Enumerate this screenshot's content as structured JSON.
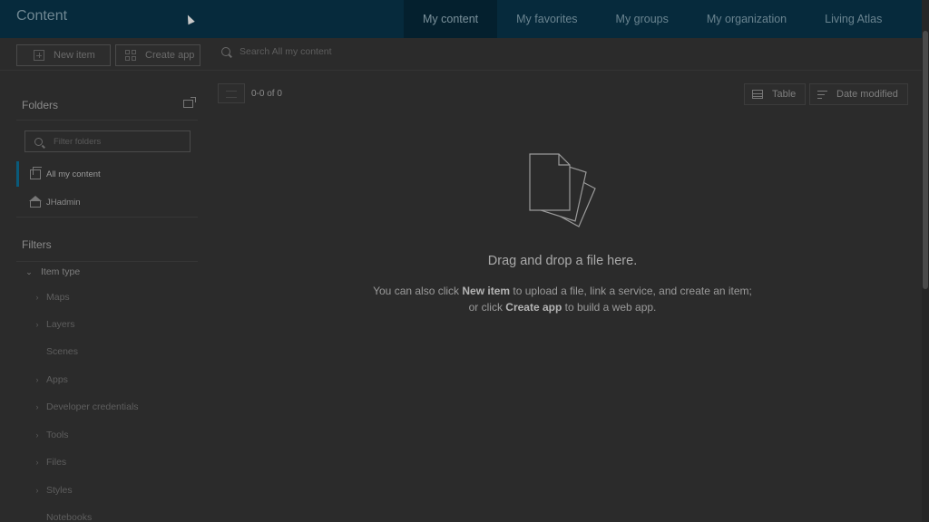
{
  "header": {
    "title": "Content",
    "tabs": [
      "My content",
      "My favorites",
      "My groups",
      "My organization",
      "Living Atlas"
    ]
  },
  "toolbar": {
    "new_item_label": "New item",
    "create_app_label": "Create app",
    "search_placeholder": "Search All my content"
  },
  "sidebar": {
    "folders_title": "Folders",
    "filter_folders_placeholder": "Filter folders",
    "folders": [
      "All my content",
      "JHadmin"
    ],
    "filters_title": "Filters",
    "item_type_label": "Item type",
    "item_types": [
      "Maps",
      "Layers",
      "Scenes",
      "Apps",
      "Developer credentials",
      "Tools",
      "Files",
      "Styles",
      "Notebooks"
    ]
  },
  "content": {
    "count": "0-0 of 0",
    "table_label": "Table",
    "sort_label": "Date modified",
    "drop_title": "Drag and drop a file here.",
    "line1_pre": "You can also click ",
    "line1_bold": "New item",
    "line1_post": " to upload a file, link a service, and create an item;",
    "line2_pre": "or click ",
    "line2_bold": "Create app",
    "line2_post": " to build a web app."
  },
  "colors": {
    "header_bg": "#062a3c",
    "active_tab_bg": "#04202e",
    "page_bg": "#2b2b2b",
    "accent": "#0a5a7a"
  }
}
